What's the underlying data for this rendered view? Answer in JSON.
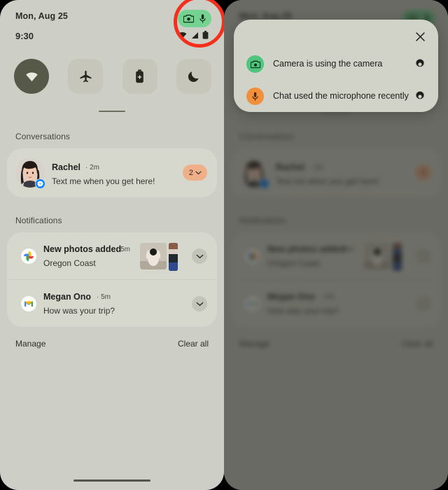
{
  "status_bar": {
    "date": "Mon, Aug 25",
    "time": "9:30",
    "wifi_icon": "wifi-icon",
    "signal_icon": "cellular-signal-icon",
    "battery_icon": "battery-icon",
    "privacy_chip": {
      "camera_icon": "camera-icon",
      "mic_icon": "microphone-icon",
      "color": "#74d391"
    }
  },
  "annotation": {
    "type": "ellipse-highlight",
    "color": "#f42f1c",
    "target": "privacy-indicator-chip"
  },
  "quick_settings": {
    "tiles": [
      {
        "name": "wifi",
        "icon": "wifi-icon",
        "active": true
      },
      {
        "name": "airplane-mode",
        "icon": "airplane-icon",
        "active": false
      },
      {
        "name": "battery-saver",
        "icon": "battery-saver-icon",
        "active": false
      },
      {
        "name": "do-not-disturb",
        "icon": "moon-icon",
        "active": false
      }
    ],
    "active_color": "#575948",
    "inactive_color": "#c6c6ba"
  },
  "sections": {
    "conversations_label": "Conversations",
    "notifications_label": "Notifications"
  },
  "conversations": [
    {
      "sender": "Rachel",
      "time": "2m",
      "message": "Text me when you get here!",
      "badge_count": "2",
      "badge_color": "#efb089",
      "app_badge_icon": "messenger-icon",
      "avatar_icon": "avatar"
    }
  ],
  "notifications": [
    {
      "app_icon": "google-photos-icon",
      "title": "New photos added",
      "time": "5m",
      "subtitle": "Oregon Coast",
      "has_thumbnails": true,
      "expand_icon": "chevron-down-icon"
    },
    {
      "app_icon": "gmail-icon",
      "title": "Megan Ono",
      "time": "5m",
      "subtitle": "How was your trip?",
      "has_thumbnails": false,
      "expand_icon": "chevron-down-icon"
    }
  ],
  "footer": {
    "manage_label": "Manage",
    "clear_all_label": "Clear all"
  },
  "privacy_dialog": {
    "close_icon": "close-icon",
    "items": [
      {
        "icon": "camera-icon",
        "icon_color": "#4ec47c",
        "text": "Camera is using the camera",
        "settings_icon": "gear-icon"
      },
      {
        "icon": "microphone-icon",
        "icon_color": "#f0903c",
        "text": "Chat used the microphone recently",
        "settings_icon": "gear-icon"
      }
    ]
  },
  "theme": {
    "shade_background": "#cdcec5",
    "card_background": "#d6d7cd",
    "dialog_background": "#d1d2c8",
    "text_primary": "#1f1f1c",
    "text_secondary": "#46463f"
  }
}
